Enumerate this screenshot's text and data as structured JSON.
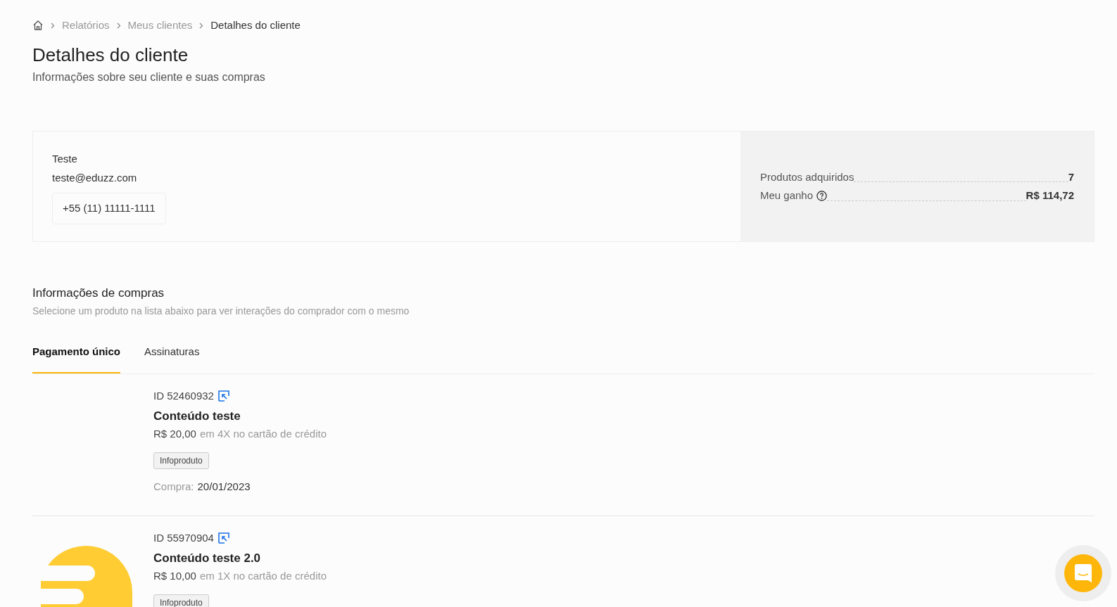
{
  "breadcrumb": [
    "Relatórios",
    "Meus clientes",
    "Detalhes do cliente"
  ],
  "page": {
    "title": "Detalhes do cliente",
    "subtitle": "Informações sobre seu cliente e suas compras"
  },
  "client": {
    "name": "Teste",
    "email": "teste@eduzz.com",
    "phone": "+55 (11) 11111-1111"
  },
  "summary": [
    {
      "label": "Produtos adquiridos",
      "value": "7",
      "help": false
    },
    {
      "label": "Meu ganho",
      "value": "R$ 114,72",
      "help": true
    }
  ],
  "purchases": {
    "title": "Informações de compras",
    "subtitle": "Selecione um produto na lista abaixo para ver interações do comprador com o mesmo"
  },
  "tabs": [
    {
      "label": "Pagamento único",
      "selected": true
    },
    {
      "label": "Assinaturas",
      "selected": false
    }
  ],
  "products": [
    {
      "kind": "plain",
      "id": "ID 52460932",
      "name": "Conteúdo teste",
      "price": "R$ 20,00",
      "payment": "em 4X no cartão de crédito",
      "tag": "Infoproduto",
      "date_label": "Compra:",
      "date": "20/01/2023"
    },
    {
      "kind": "logo",
      "id": "ID 55970904",
      "name": "Conteúdo teste 2.0",
      "price": "R$ 10,00",
      "payment": "em 1X no cartão de crédito",
      "tag": "Infoproduto"
    }
  ]
}
